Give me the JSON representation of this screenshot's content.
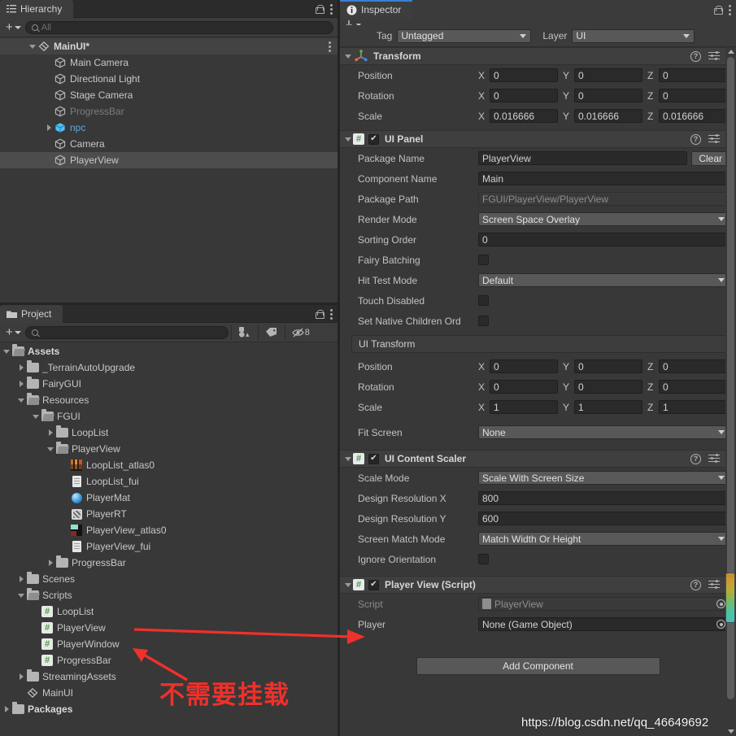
{
  "hierarchy": {
    "tab_label": "Hierarchy",
    "tab_icon": "hierarchy-icon",
    "add_label": "+",
    "search_placeholder": "All",
    "items": [
      {
        "label": "MainUI*",
        "icon": "scene-icon",
        "depth": 1,
        "arrow": "open",
        "style": "bold"
      },
      {
        "label": "Main Camera",
        "icon": "cube-icon",
        "depth": 2,
        "arrow": "none",
        "style": "normal"
      },
      {
        "label": "Directional Light",
        "icon": "cube-icon",
        "depth": 2,
        "arrow": "none",
        "style": "normal"
      },
      {
        "label": "Stage Camera",
        "icon": "cube-icon",
        "depth": 2,
        "arrow": "none",
        "style": "normal"
      },
      {
        "label": "ProgressBar",
        "icon": "cube-icon",
        "depth": 2,
        "arrow": "none",
        "style": "dim"
      },
      {
        "label": "npc",
        "icon": "prefab-icon",
        "depth": 2,
        "arrow": "closed",
        "style": "blue"
      },
      {
        "label": "Camera",
        "icon": "cube-icon",
        "depth": 2,
        "arrow": "none",
        "style": "normal"
      },
      {
        "label": "PlayerView",
        "icon": "cube-icon",
        "depth": 2,
        "arrow": "none",
        "style": "selected"
      }
    ]
  },
  "project": {
    "tab_label": "Project",
    "tab_icon": "folder-icon",
    "add_label": "+",
    "search_placeholder": "",
    "filter_count": "8",
    "items": [
      {
        "label": "Assets",
        "icon": "folder-open-icon",
        "depth": 0,
        "arrow": "open",
        "style": "bold"
      },
      {
        "label": "_TerrainAutoUpgrade",
        "icon": "folder-icon",
        "depth": 1,
        "arrow": "closed",
        "style": "normal"
      },
      {
        "label": "FairyGUI",
        "icon": "folder-icon",
        "depth": 1,
        "arrow": "closed",
        "style": "normal"
      },
      {
        "label": "Resources",
        "icon": "folder-open-icon",
        "depth": 1,
        "arrow": "open",
        "style": "normal"
      },
      {
        "label": "FGUI",
        "icon": "folder-open-icon",
        "depth": 2,
        "arrow": "open",
        "style": "normal"
      },
      {
        "label": "LoopList",
        "icon": "folder-icon",
        "depth": 3,
        "arrow": "closed",
        "style": "normal"
      },
      {
        "label": "PlayerView",
        "icon": "folder-open-icon",
        "depth": 3,
        "arrow": "open",
        "style": "normal"
      },
      {
        "label": "LoopList_atlas0",
        "icon": "atlas1-icon",
        "depth": 4,
        "arrow": "none",
        "style": "normal"
      },
      {
        "label": "LoopList_fui",
        "icon": "file-icon",
        "depth": 4,
        "arrow": "none",
        "style": "normal"
      },
      {
        "label": "PlayerMat",
        "icon": "material-icon",
        "depth": 4,
        "arrow": "none",
        "style": "normal"
      },
      {
        "label": "PlayerRT",
        "icon": "rendertexture-icon",
        "depth": 4,
        "arrow": "none",
        "style": "normal"
      },
      {
        "label": "PlayerView_atlas0",
        "icon": "atlas2-icon",
        "depth": 4,
        "arrow": "none",
        "style": "normal"
      },
      {
        "label": "PlayerView_fui",
        "icon": "file-icon",
        "depth": 4,
        "arrow": "none",
        "style": "normal"
      },
      {
        "label": "ProgressBar",
        "icon": "folder-icon",
        "depth": 3,
        "arrow": "closed",
        "style": "normal"
      },
      {
        "label": "Scenes",
        "icon": "folder-icon",
        "depth": 1,
        "arrow": "closed",
        "style": "normal"
      },
      {
        "label": "Scripts",
        "icon": "folder-open-icon",
        "depth": 1,
        "arrow": "open",
        "style": "normal"
      },
      {
        "label": "LoopList",
        "icon": "csharp-icon",
        "depth": 2,
        "arrow": "none",
        "style": "normal"
      },
      {
        "label": "PlayerView",
        "icon": "csharp-icon",
        "depth": 2,
        "arrow": "none",
        "style": "normal"
      },
      {
        "label": "PlayerWindow",
        "icon": "csharp-icon",
        "depth": 2,
        "arrow": "none",
        "style": "normal"
      },
      {
        "label": "ProgressBar",
        "icon": "csharp-icon",
        "depth": 2,
        "arrow": "none",
        "style": "normal"
      },
      {
        "label": "StreamingAssets",
        "icon": "folder-icon",
        "depth": 1,
        "arrow": "closed",
        "style": "normal"
      },
      {
        "label": "MainUI",
        "icon": "scene-icon",
        "depth": 1,
        "arrow": "none",
        "style": "normal"
      },
      {
        "label": "Packages",
        "icon": "folder-icon",
        "depth": 0,
        "arrow": "closed",
        "style": "bold"
      }
    ]
  },
  "inspector": {
    "tab_label": "Inspector",
    "tab_icon": "info-icon",
    "tag": {
      "label": "Tag",
      "value": "Untagged"
    },
    "layer": {
      "label": "Layer",
      "value": "UI"
    },
    "transform": {
      "title": "Transform",
      "icon": "transform-icon",
      "position": {
        "label": "Position",
        "x": "0",
        "y": "0",
        "z": "0"
      },
      "rotation": {
        "label": "Rotation",
        "x": "0",
        "y": "0",
        "z": "0"
      },
      "scale": {
        "label": "Scale",
        "x": "0.016666",
        "y": "0.016666",
        "z": "0.016666"
      }
    },
    "ui_panel": {
      "title": "UI Panel",
      "icon": "csharp-icon",
      "enabled": true,
      "package_name": {
        "label": "Package Name",
        "value": "PlayerView",
        "clear_label": "Clear"
      },
      "component_name": {
        "label": "Component Name",
        "value": "Main"
      },
      "package_path": {
        "label": "Package Path",
        "value": "FGUI/PlayerView/PlayerView"
      },
      "render_mode": {
        "label": "Render Mode",
        "value": "Screen Space Overlay"
      },
      "sorting_order": {
        "label": "Sorting Order",
        "value": "0"
      },
      "fairy_batching": {
        "label": "Fairy Batching",
        "checked": false
      },
      "hit_test_mode": {
        "label": "Hit Test Mode",
        "value": "Default"
      },
      "touch_disabled": {
        "label": "Touch Disabled",
        "checked": false
      },
      "set_native_children_order": {
        "label": "Set Native Children Ord",
        "checked": false
      },
      "ui_transform": {
        "title": "UI Transform",
        "position": {
          "label": "Position",
          "x": "0",
          "y": "0",
          "z": "0"
        },
        "rotation": {
          "label": "Rotation",
          "x": "0",
          "y": "0",
          "z": "0"
        },
        "scale": {
          "label": "Scale",
          "x": "1",
          "y": "1",
          "z": "1"
        },
        "fit_screen": {
          "label": "Fit Screen",
          "value": "None"
        }
      }
    },
    "ui_content_scaler": {
      "title": "UI Content Scaler",
      "icon": "csharp-icon",
      "enabled": true,
      "scale_mode": {
        "label": "Scale Mode",
        "value": "Scale With Screen Size"
      },
      "design_resolution_x": {
        "label": "Design Resolution X",
        "value": "800"
      },
      "design_resolution_y": {
        "label": "Design Resolution Y",
        "value": "600"
      },
      "screen_match_mode": {
        "label": "Screen Match Mode",
        "value": "Match Width Or Height"
      },
      "ignore_orientation": {
        "label": "Ignore Orientation",
        "checked": false
      }
    },
    "player_view_script": {
      "title": "Player View (Script)",
      "icon": "csharp-icon",
      "enabled": true,
      "script": {
        "label": "Script",
        "value": "PlayerView"
      },
      "player": {
        "label": "Player",
        "value": "None (Game Object)"
      }
    },
    "add_component_label": "Add Component"
  },
  "annotations": {
    "chinese_note": "不需要挂载",
    "watermark": "https://blog.csdn.net/qq_46649692",
    "arrow_color": "#f0302a"
  },
  "colors": {
    "window_bg": "#383838",
    "panel_header": "#2b2b2b",
    "tab_active": "#3d3d3d",
    "field_bg": "#2a2a2a",
    "dropdown_bg": "#585858",
    "selection": "#4d4d4d",
    "accent_blue": "#3b7fd4",
    "text": "#c4c4c4",
    "text_dim": "#7c7c7c"
  }
}
